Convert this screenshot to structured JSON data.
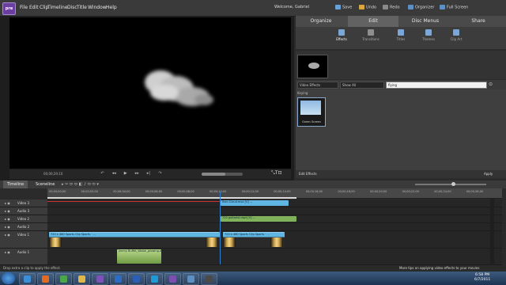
{
  "app": {
    "logo": "pre"
  },
  "menubar": {
    "items": [
      "File",
      "Edit",
      "Clip",
      "Timeline",
      "Disc",
      "Title",
      "Window",
      "Help"
    ],
    "welcome": "Welcome, Gabriel",
    "tools": [
      "Save",
      "Undo",
      "Redo",
      "Organizer",
      "Full Screen"
    ]
  },
  "monitor": {
    "timecode": "00;00;29;10",
    "transport_icons": [
      "step-back",
      "rewind",
      "play",
      "fast-forward",
      "step-forward",
      "loop"
    ]
  },
  "panel": {
    "tabs": [
      "Organize",
      "Edit",
      "Disc Menus",
      "Share"
    ],
    "active_tab": "Edit",
    "subtools": [
      "Effects",
      "Transitions",
      "Titles",
      "Themes",
      "Clip Art"
    ],
    "filter_category": "Video Effects",
    "filter_show": "Show All",
    "search_value": "flying",
    "category_label": "Keying",
    "effect_name": "Green Screen",
    "footer_left": "Edit Effects",
    "footer_right": "Apply"
  },
  "timeline": {
    "tabs": [
      "Timeline",
      "Sceneline"
    ],
    "ruler_ticks": [
      "00;00;00;00",
      "00;00;02;00",
      "00;00;04;00",
      "00;00;06;00",
      "00;00;08;00",
      "00;00;10;00",
      "00;00;12;00",
      "00;00;14;00",
      "00;00;16;00",
      "00;00;18;00",
      "00;00;20;00",
      "00;00;22;00",
      "00;00;24;00",
      "00;00;26;00"
    ],
    "tracks": [
      {
        "name": "Video 3",
        "clips": [
          {
            "label": "Rain Cloud.mov [V] ...",
            "type": "video"
          }
        ]
      },
      {
        "name": "Audio 3",
        "clips": []
      },
      {
        "name": "Video 2",
        "clips": [
          {
            "label": "720 guitarist.mp4 [V] ...",
            "type": "green"
          }
        ]
      },
      {
        "name": "Audio 2",
        "clips": []
      },
      {
        "name": "Video 1",
        "clips": [
          {
            "label": "720 x 480 Sports Clip Sports · ...",
            "type": "video"
          },
          {
            "label": "720 x 480 Sports Clip Sports · ...",
            "type": "video"
          }
        ]
      },
      {
        "name": "Audio 1",
        "clips": [
          {
            "label": "Jimmy Buffet_Waste_growing.wav",
            "type": "audio"
          }
        ]
      }
    ]
  },
  "status": {
    "left": "Drop extra a clip to apply the effect.",
    "right": "More tips on applying video effects to your movies"
  },
  "taskbar": {
    "apps": [
      "ie",
      "firefox",
      "chrome",
      "folder",
      "media",
      "outlook",
      "word",
      "skype",
      "premiere",
      "photos",
      "mediaplayer"
    ],
    "time": "6:58 PM",
    "date": "6/7/2011"
  }
}
